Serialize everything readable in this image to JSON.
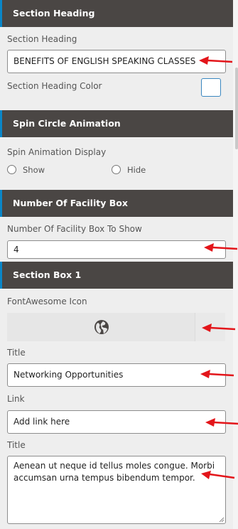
{
  "section_heading_panel": {
    "header": "Section Heading",
    "heading_label": "Section Heading",
    "heading_value": "BENEFITS OF ENGLISH SPEAKING CLASSES",
    "color_label": "Section Heading Color",
    "color_value": "#ffffff"
  },
  "spin_panel": {
    "header": "Spin Circle Animation",
    "display_label": "Spin Animation Display",
    "options": [
      "Show",
      "Hide"
    ]
  },
  "facility_panel": {
    "header": "Number Of Facility Box",
    "count_label": "Number Of Facility Box To Show",
    "count_value": "4"
  },
  "section_box_1": {
    "header": "Section Box 1",
    "icon_label": "FontAwesome Icon",
    "icon_name": "globe-icon",
    "title_label": "Title",
    "title_value": "Networking Opportunities",
    "link_label": "Link",
    "link_placeholder": "Add link here",
    "desc_label": "Title",
    "desc_value": "Aenean ut neque id tellus moles congue. Morbi accumsan urna tempus bibendum tempor."
  },
  "colors": {
    "header_bg": "#4a4644",
    "header_accent": "#0a86c8",
    "arrow": "#e3151a",
    "panel_bg": "#eeeeee"
  }
}
